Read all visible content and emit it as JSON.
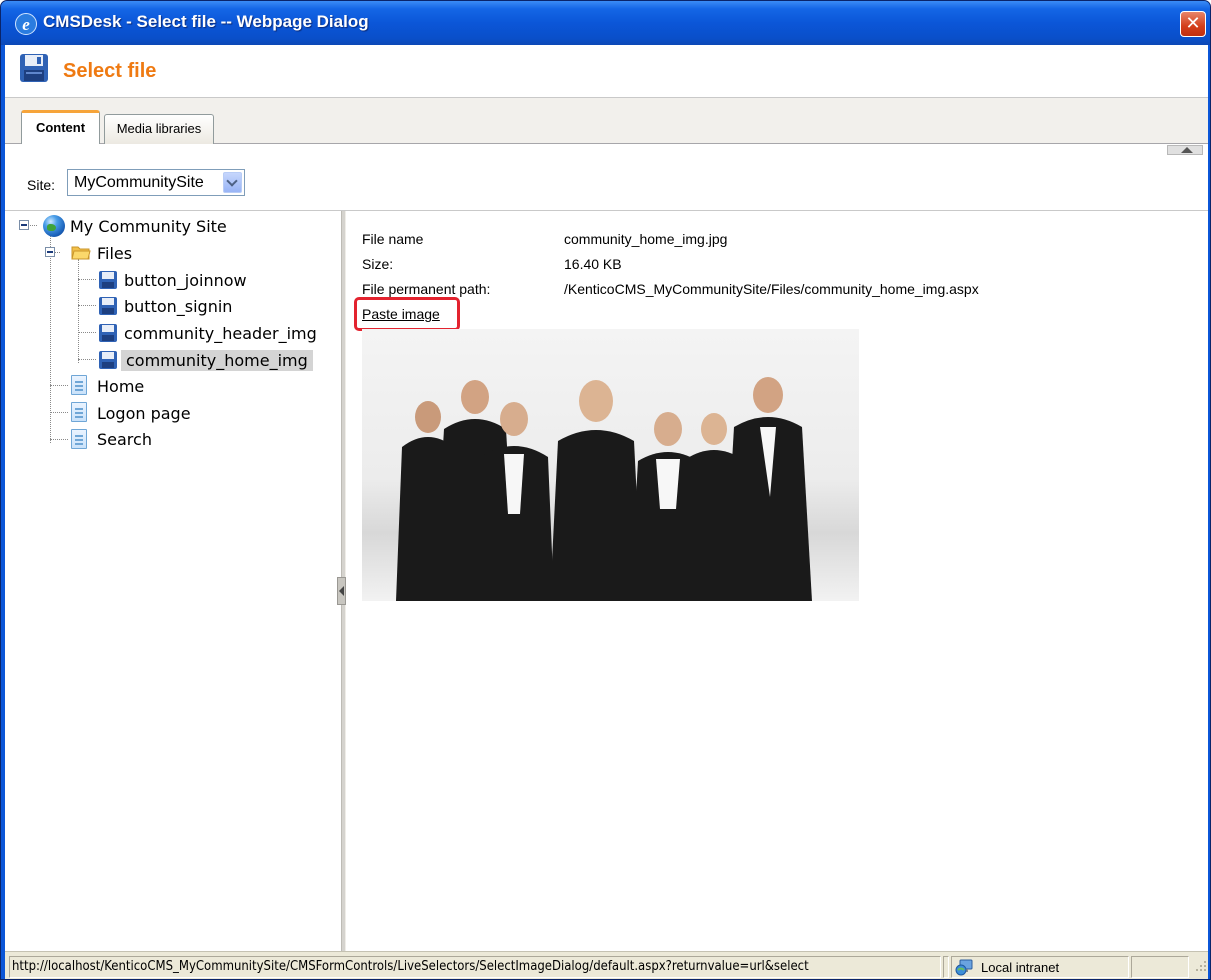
{
  "window": {
    "title": "CMSDesk - Select file -- Webpage Dialog",
    "close_glyph": "✕"
  },
  "header": {
    "title": "Select file",
    "icon": "floppy-disk-icon"
  },
  "tabs": [
    {
      "label": "Content",
      "active": true
    },
    {
      "label": "Media libraries",
      "active": false
    }
  ],
  "site": {
    "label": "Site:",
    "selected": "MyCommunitySite"
  },
  "tree": {
    "root": "My Community Site",
    "nodes": [
      {
        "label": "Files",
        "icon": "folder-icon"
      },
      {
        "label": "button_joinnow",
        "icon": "floppy-icon"
      },
      {
        "label": "button_signin",
        "icon": "floppy-icon"
      },
      {
        "label": "community_header_img",
        "icon": "floppy-icon"
      },
      {
        "label": "community_home_img",
        "icon": "floppy-icon",
        "selected": true
      },
      {
        "label": "Home",
        "icon": "page-icon"
      },
      {
        "label": "Logon page",
        "icon": "page-icon"
      },
      {
        "label": "Search",
        "icon": "page-icon"
      }
    ]
  },
  "details": {
    "file_name_label": "File name",
    "file_name": "community_home_img.jpg",
    "size_label": "Size:",
    "size": "16.40 KB",
    "path_label": "File permanent path:",
    "path": "/KenticoCMS_MyCommunitySite/Files/community_home_img.aspx",
    "paste_label": "Paste image",
    "highlight_color": "#e3232f"
  },
  "status": {
    "url": "http://localhost/KenticoCMS_MyCommunitySite/CMSFormControls/LiveSelectors/SelectImageDialog/default.aspx?returnvalue=url&select",
    "zone": "Local intranet"
  },
  "colors": {
    "title_bar": "#0b56d8",
    "header_title": "#ef7a12",
    "tab_accent": "#f6a43a"
  }
}
